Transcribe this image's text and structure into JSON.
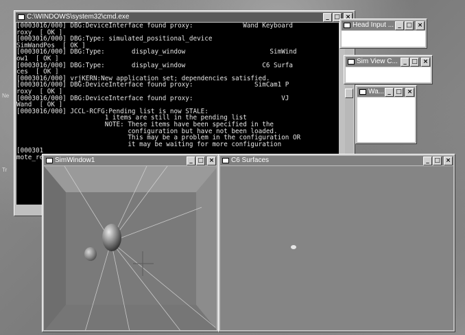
{
  "desktop": {
    "labels": [
      "Ne",
      "Tr"
    ]
  },
  "cmd": {
    "title": "C:\\WINDOWS\\system32\\cmd.exe",
    "lines": [
      "[0003016/000] DBG:DeviceInterface found proxy:             Wand Keyboard",
      "roxy  [ OK ]",
      "[0003016/000] DBG:Type: simulated_positional_device",
      "SimWandPos  [ OK ]",
      "[0003016/000] DBG:Type:       display_window                      SimWind",
      "ow1  [ OK ]",
      "[0003016/000] DBG:Type:       display_window                    C6 Surfa",
      "ces  [ OK ]",
      "[0003016/000] vrjKERN:New application set; dependencies satisfied.",
      "[0003016/000] DBG:DeviceInterface found proxy:                SimCam1 P",
      "roxy  [ OK ]",
      "[0003016/000] DBG:DeviceInterface found proxy:                       VJ",
      "Wand  [ OK ]",
      "[0003016/000] JCCL-RCFG:Pending list is now STALE:",
      "                       1 items are still in the pending list",
      "                       NOTE: These items have been specified in the",
      "                             configuration but have not been loaded.",
      "                             This may be a problem in the configuration OR",
      "                             it may be waiting for more configuration",
      "[000301",
      "",
      "mote_re"
    ]
  },
  "head_input": {
    "title": "Head Input ..."
  },
  "sim_view": {
    "title": "Sim View C..."
  },
  "wand": {
    "title": "Wa..."
  },
  "sim_window1": {
    "title": "SimWindow1"
  },
  "c6_surfaces": {
    "title": "C6 Surfaces"
  },
  "window_controls": {
    "minimize": "_",
    "maximize": "□",
    "close": "×"
  }
}
